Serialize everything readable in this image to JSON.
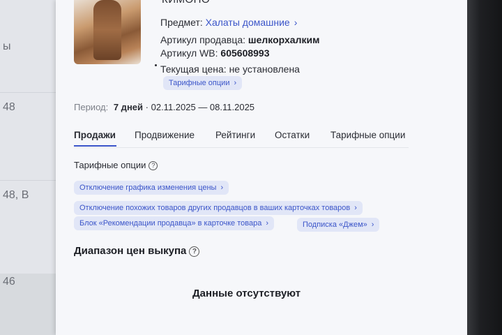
{
  "background_left": {
    "rows": [
      {
        "text": "ы"
      },
      {
        "text": "48"
      },
      {
        "text": "48, В"
      },
      {
        "text": "46"
      }
    ]
  },
  "product": {
    "title_partial": "КИМОНО",
    "subject_label": "Предмет:",
    "subject_value": "Халаты домашние",
    "seller_article_label": "Артикул продавца:",
    "seller_article_value": "шелкорхалким",
    "wb_article_label": "Артикул WB:",
    "wb_article_value": "605608993",
    "current_price_label": "Текущая цена:",
    "current_price_value": "не установлена",
    "tariff_chip": "Тарифные опции"
  },
  "period": {
    "label": "Период:",
    "days": "7 дней",
    "separator": "·",
    "range": "02.11.2025 — 08.11.2025"
  },
  "tabs": [
    {
      "label": "Продажи",
      "active": true
    },
    {
      "label": "Продвижение",
      "active": false
    },
    {
      "label": "Рейтинги",
      "active": false
    },
    {
      "label": "Остатки",
      "active": false
    },
    {
      "label": "Тарифные опции",
      "active": false
    }
  ],
  "tariff_section": {
    "title": "Тарифные опции",
    "chips": [
      "Отключение графика изменения цены",
      "Отключение похожих товаров других продавцов в ваших карточках товаров",
      "Блок «Рекомендации продавца» в карточке товара",
      "Подписка «Джем»"
    ]
  },
  "buyout_section": {
    "title": "Диапазон цен выкупа",
    "empty_text": "Данные отсутствуют"
  },
  "colors": {
    "accent": "#3b55c9",
    "chip_bg": "#e1e6f7",
    "panel_bg": "#f6f7fa"
  },
  "icons": {
    "chevron": "chevron-right-icon",
    "help": "question-circle-icon"
  }
}
